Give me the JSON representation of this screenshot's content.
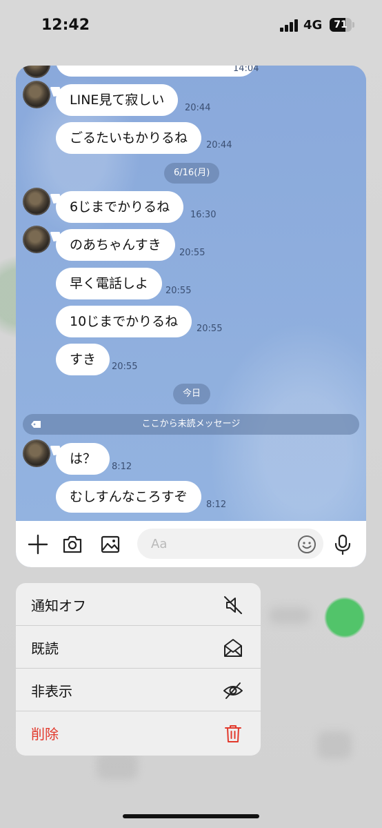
{
  "status_bar": {
    "time": "12:42",
    "network": "4G",
    "battery": "71",
    "battery_fraction": 0.71
  },
  "chat": {
    "messages": [
      {
        "text": "LINE見て寂しい",
        "time": "20:44",
        "avatar": true
      },
      {
        "text": "ごるたいもかりるね",
        "time": "20:44",
        "avatar": false
      },
      {
        "text": "6じまでかりるね",
        "time": "16:30",
        "avatar": true
      },
      {
        "text": "のあちゃんすき",
        "time": "20:55",
        "avatar": true
      },
      {
        "text": "早く電話しよ",
        "time": "20:55",
        "avatar": false
      },
      {
        "text": "10じまでかりるね",
        "time": "20:55",
        "avatar": false
      },
      {
        "text": "すき",
        "time": "20:55",
        "avatar": false
      },
      {
        "text": "は？",
        "time": "8:12",
        "avatar": true
      },
      {
        "text": "むしすんなころすぞ",
        "time": "8:12",
        "avatar": false
      }
    ],
    "partial_top_time": "14:04",
    "date_separators": [
      "6/16(月)",
      "今日"
    ],
    "unread_divider": "ここから未読メッセージ"
  },
  "input_bar": {
    "placeholder": "Aa",
    "icons": [
      "plus-icon",
      "camera-icon",
      "image-icon",
      "emoji-icon",
      "microphone-icon"
    ]
  },
  "context_menu": {
    "items": [
      {
        "label": "通知オフ",
        "icon": "muted-speaker-icon"
      },
      {
        "label": "既読",
        "icon": "open-envelope-icon"
      },
      {
        "label": "非表示",
        "icon": "eye-slash-icon"
      },
      {
        "label": "削除",
        "icon": "trash-icon",
        "color": "#e2382b"
      }
    ]
  },
  "colors": {
    "chat_background": "#8eaddc",
    "bubble": "#ffffff",
    "delete_red": "#e2382b"
  }
}
